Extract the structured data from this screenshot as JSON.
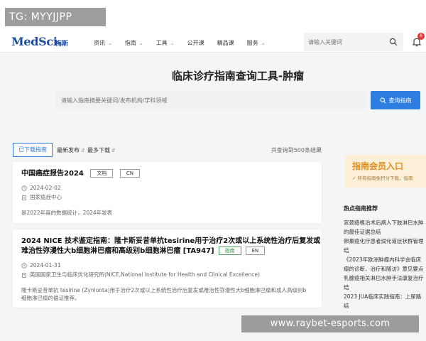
{
  "overlay": {
    "tg": "TG: MYYJJPP",
    "url": "www.raybet-esports.com"
  },
  "header": {
    "logo": "MedSci",
    "logo_sub": "梅斯",
    "nav": [
      {
        "label": "资讯",
        "has_caret": true
      },
      {
        "label": "指南",
        "has_caret": true
      },
      {
        "label": "工具",
        "has_caret": true
      },
      {
        "label": "公开课",
        "has_caret": false
      },
      {
        "label": "精品课",
        "has_caret": false
      },
      {
        "label": "服务",
        "has_caret": true
      }
    ],
    "search_placeholder": "请输入关键词",
    "notification_count": "6"
  },
  "page": {
    "title": "临床诊疗指南查询工具-肿瘤",
    "query_placeholder": "请输入指南摘要关键词/发布机构/学科领域",
    "query_button": "查询指南"
  },
  "filters": {
    "tab": "已下载指南",
    "sort_latest": "最新发布",
    "sort_downloads": "最多下载",
    "total": "共查询到500条结果"
  },
  "results": [
    {
      "title": "中国癌症报告2024",
      "tags": [
        "文档",
        "CN"
      ],
      "date": "2024-02-02",
      "org": "国家癌症中心",
      "desc": "是2022年度的数据统计，2024年发表"
    },
    {
      "title_line1": "2024 NICE 技术鉴定指南：隆卡斯妥昔单抗tesirine用于治疗2次或以上系统性治疗后复发或",
      "title_line2": "难治性弥漫性大b细胞淋巴瘤和高级别b细胞淋巴瘤 [TA947]",
      "tags": [
        "指南",
        "EN"
      ],
      "date": "2024-01-31",
      "org": "英国国家卫生与临床优化研究所(NICE,National Institute for Health and Clinical Excellence)",
      "desc_line1": "隆卡斯妥昔单抗 tesirine (Zynlonta)用于治疗2次或以上系统性治疗后复发或难治性弥漫性大b细胞淋巴瘤和成人高级别b",
      "desc_line2": "细胞淋巴瘤的循证推荐。"
    }
  ],
  "sidebar": {
    "banner_title": "指南会员入口",
    "banner_sub": "所有指南免积分下载，指南",
    "heading": "热点指南推荐",
    "items": [
      "宫颈癌根治术后病人下肢淋巴水肿",
      "的最佳证据总结",
      "卵巢癌化疗患者润化道症状群管理",
      "结",
      "《2023年欧洲肿瘤内科学会临床",
      "瘤的诊断、治疗和随访》意见要点",
      "乳腺癌相关淋巴水肿手法康复治疗",
      "结",
      "2023 JUA临床实践指南：上尿路",
      "结"
    ]
  },
  "colors": {
    "brand": "#1f4c9a",
    "accent": "#2e7de1",
    "banner": "#e08e1c"
  }
}
